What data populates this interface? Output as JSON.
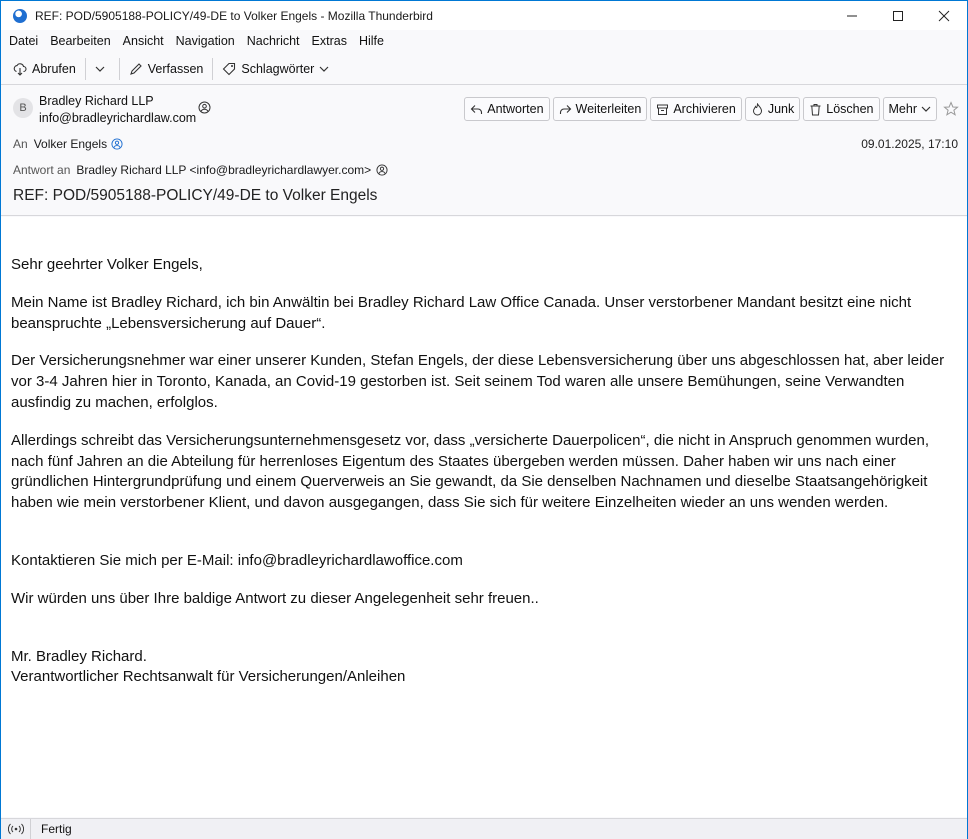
{
  "window": {
    "title": "REF: POD/5905188-POLICY/49-DE to Volker Engels - Mozilla Thunderbird",
    "controls": {
      "minimize": "—",
      "maximize": "☐",
      "close": "✕"
    }
  },
  "menu": [
    "Datei",
    "Bearbeiten",
    "Ansicht",
    "Navigation",
    "Nachricht",
    "Extras",
    "Hilfe"
  ],
  "toolbar": {
    "get_mail": "Abrufen",
    "compose": "Verfassen",
    "tags": "Schlagwörter"
  },
  "header": {
    "avatar_letter": "B",
    "sender_name": "Bradley Richard LLP",
    "sender_email": "info@bradleyrichardlaw.com",
    "buttons": {
      "reply": "Antworten",
      "forward": "Weiterleiten",
      "archive": "Archivieren",
      "junk": "Junk",
      "delete": "Löschen",
      "more": "Mehr"
    },
    "to_label": "An",
    "to_value": "Volker Engels",
    "date": "09.01.2025, 17:10",
    "reply_to_label": "Antwort an",
    "reply_to_value": "Bradley Richard LLP <info@bradleyrichardlawyer.com>",
    "subject": "REF: POD/5905188-POLICY/49-DE to Volker Engels"
  },
  "body": {
    "greeting": "Sehr geehrter Volker Engels,",
    "p1": "Mein Name ist Bradley Richard, ich bin Anwältin bei Bradley Richard Law Office Canada. Unser verstorbener Mandant besitzt eine nicht beanspruchte „Lebensversicherung auf Dauer“.",
    "p2": "Der Versicherungsnehmer war einer unserer Kunden, Stefan Engels, der diese Lebensversicherung über uns abgeschlossen hat, aber leider vor 3-4 Jahren hier in Toronto, Kanada, an Covid-19 gestorben ist. Seit seinem Tod waren alle unsere Bemühungen, seine Verwandten ausfindig zu machen, erfolglos.",
    "p3": "Allerdings schreibt das Versicherungsunternehmensgesetz vor, dass „versicherte Dauerpolicen“, die nicht in Anspruch genommen wurden, nach fünf Jahren an die Abteilung für herrenloses Eigentum des Staates übergeben werden müssen. Daher haben wir uns nach einer gründlichen Hintergrundprüfung und einem Querverweis an Sie gewandt, da Sie denselben Nachnamen und dieselbe Staatsangehörigkeit haben wie mein verstorbener Klient, und davon ausgegangen, dass Sie sich für weitere Einzelheiten wieder an uns wenden werden.",
    "contact": "Kontaktieren Sie mich per E-Mail: info@bradleyrichardlawoffice.com",
    "closing": "Wir würden uns über Ihre baldige Antwort zu dieser Angelegenheit sehr freuen..",
    "sig_name": "Mr. Bradley Richard.",
    "sig_title": "Verantwortlicher Rechtsanwalt für Versicherungen/Anleihen"
  },
  "status": {
    "text": "Fertig"
  }
}
